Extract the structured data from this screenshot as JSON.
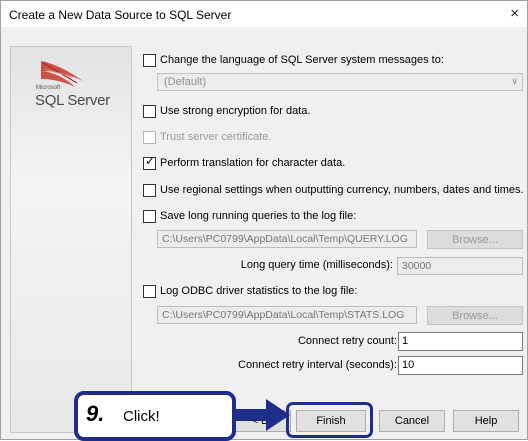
{
  "window": {
    "title": "Create a New Data Source to SQL Server",
    "close_glyph": "×"
  },
  "logo": {
    "brand_small": "Microsoft",
    "brand": "SQL Server"
  },
  "options": {
    "change_language": {
      "label": "Change the language of SQL Server system messages to:",
      "checked": false
    },
    "language_select": {
      "value": "(Default)"
    },
    "strong_encryption": {
      "label": "Use strong encryption for data.",
      "checked": false
    },
    "trust_certificate": {
      "label": "Trust server certificate.",
      "checked": false
    },
    "perform_translation": {
      "label": "Perform translation for character data.",
      "checked": true
    },
    "regional_settings": {
      "label": "Use regional settings when outputting currency, numbers, dates and times.",
      "checked": false
    },
    "save_long_queries": {
      "label": "Save long running queries to the log file:",
      "checked": false
    },
    "query_log_path": "C:\\Users\\PC0799\\AppData\\Local\\Temp\\QUERY.LOG",
    "long_query_time_label": "Long query time (milliseconds):",
    "long_query_time_value": "30000",
    "log_odbc_stats": {
      "label": "Log ODBC driver statistics to the log file:",
      "checked": false
    },
    "stats_log_path": "C:\\Users\\PC0799\\AppData\\Local\\Temp\\STATS.LOG",
    "connect_retry_count_label": "Connect retry count:",
    "connect_retry_count_value": "1",
    "connect_retry_interval_label": "Connect retry interval (seconds):",
    "connect_retry_interval_value": "10"
  },
  "buttons": {
    "browse": "Browse...",
    "back_partial": "< B",
    "finish": "Finish",
    "cancel": "Cancel",
    "help": "Help"
  },
  "annotation": {
    "step": "9.",
    "text": "Click!"
  },
  "colors": {
    "annotation": "#1f2e8a",
    "logo_red": "#c8362f"
  }
}
